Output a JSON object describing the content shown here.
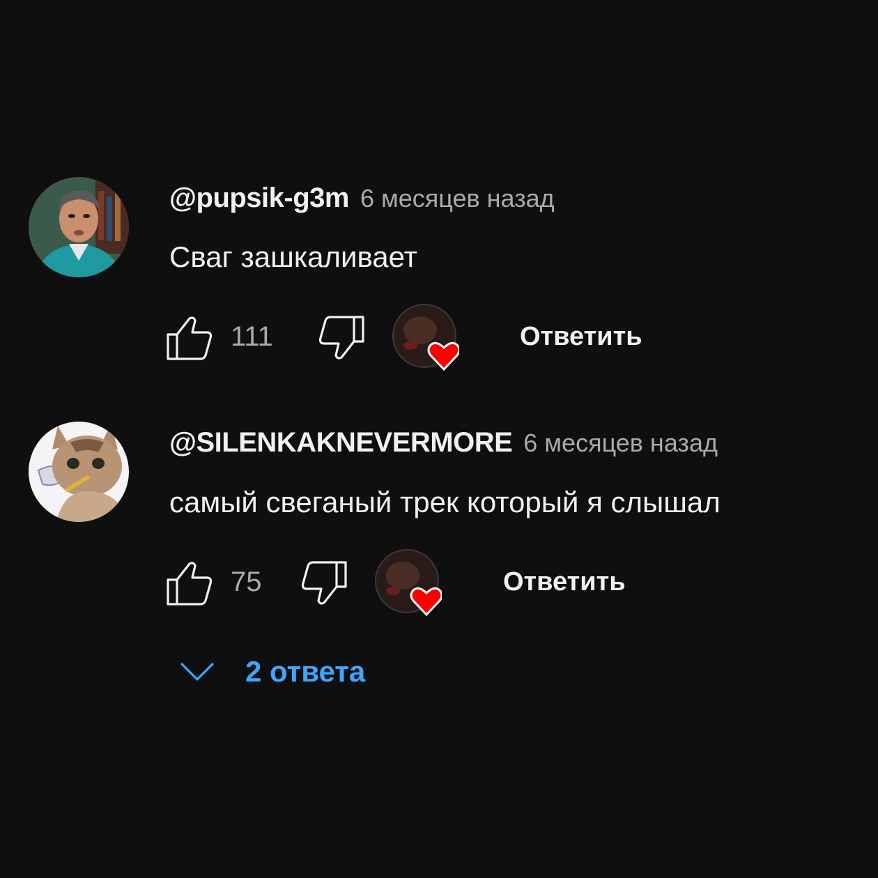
{
  "comments": [
    {
      "author": "@pupsik-g3m",
      "time": "6 месяцев назад",
      "text": "Сваг зашкаливает",
      "likes": "111",
      "reply_label": "Ответить",
      "avatar_icon": "man-portrait-avatar",
      "creator_heart": true
    },
    {
      "author": "@SILENKAKNEVERMORE",
      "time": "6 месяцев назад",
      "text": "самый свеганый трек который я слышал",
      "likes": "75",
      "reply_label": "Ответить",
      "avatar_icon": "cat-avatar",
      "creator_heart": true
    }
  ],
  "replies_toggle": {
    "label": "2 ответа",
    "icon": "chevron-down-icon"
  },
  "colors": {
    "background": "#0f0f10",
    "text_primary": "#f1f1f1",
    "text_secondary": "#aaaaaa",
    "link_blue": "#3ea6ff",
    "heart_red": "#ff0000"
  }
}
